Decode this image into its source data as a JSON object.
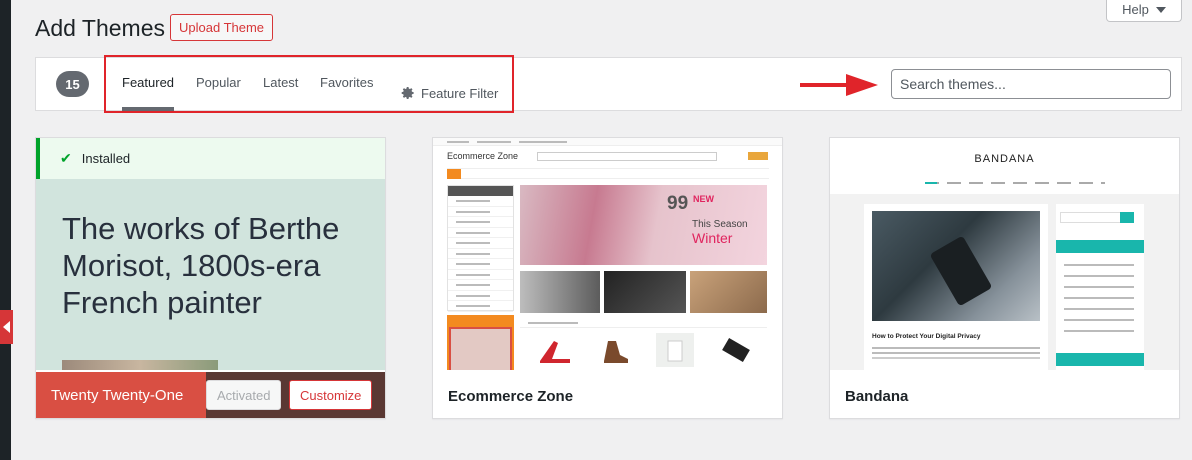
{
  "page": {
    "title": "Add Themes",
    "upload_button": "Upload Theme",
    "help_label": "Help"
  },
  "filter_bar": {
    "count": "15",
    "tabs": [
      {
        "label": "Featured",
        "active": true
      },
      {
        "label": "Popular",
        "active": false
      },
      {
        "label": "Latest",
        "active": false
      },
      {
        "label": "Favorites",
        "active": false
      }
    ],
    "feature_filter_label": "Feature Filter",
    "feature_filter_icon": "gear-icon",
    "search_placeholder": "Search themes..."
  },
  "annotations": {
    "highlight_color": "#e0242a",
    "arrow_color": "#e0242a"
  },
  "themes": [
    {
      "name": "Twenty Twenty-One",
      "installed_label": "Installed",
      "preview_headline": "The works of Berthe Morisot, 1800s-era French painter",
      "activated_label": "Activated",
      "customize_label": "Customize"
    },
    {
      "name": "Ecommerce Zone",
      "preview": {
        "logo": "Ecommerce Zone",
        "hero_number": "99",
        "hero_new": "NEW",
        "hero_line": "This Season",
        "hero_big": "Winter"
      }
    },
    {
      "name": "Bandana",
      "preview": {
        "site_title": "BANDANA",
        "post_title": "How to Protect Your Digital Privacy"
      }
    }
  ],
  "colors": {
    "accent_red": "#d63638",
    "installed_green": "#00a32a",
    "tt1_bg": "#d1e4dd",
    "tt1_name_bg": "#d94f43"
  }
}
